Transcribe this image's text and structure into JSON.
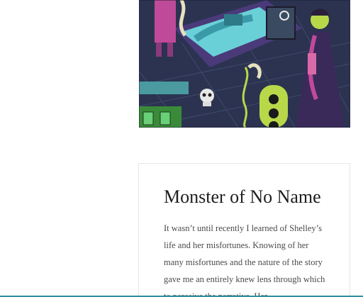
{
  "article": {
    "title": "Monster of No Name",
    "body": "It wasn’t until recently I learned of Shelley’s life and her misfortunes. Knowing of her many misfortunes and the nature of the story gave me an entirely knew lens through which to perceive the narrative. Her"
  },
  "colors": {
    "title": "#1e1e1e",
    "body": "#4a4a4a",
    "card_border": "#e6e6e6",
    "bottom_bar": "#2f8f9f"
  }
}
